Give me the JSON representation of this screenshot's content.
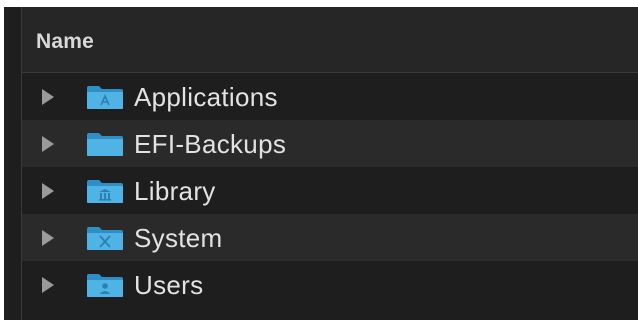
{
  "header": {
    "name_label": "Name"
  },
  "rows": [
    {
      "label": "Applications",
      "icon": "applications-folder-icon"
    },
    {
      "label": "EFI-Backups",
      "icon": "folder-icon"
    },
    {
      "label": "Library",
      "icon": "library-folder-icon"
    },
    {
      "label": "System",
      "icon": "system-folder-icon"
    },
    {
      "label": "Users",
      "icon": "users-folder-icon"
    }
  ],
  "colors": {
    "background": "#1e1e1e",
    "row_alt": "#2a2a2a",
    "folder_blue": "#3aa6dd",
    "text": "#e2e2e2"
  }
}
